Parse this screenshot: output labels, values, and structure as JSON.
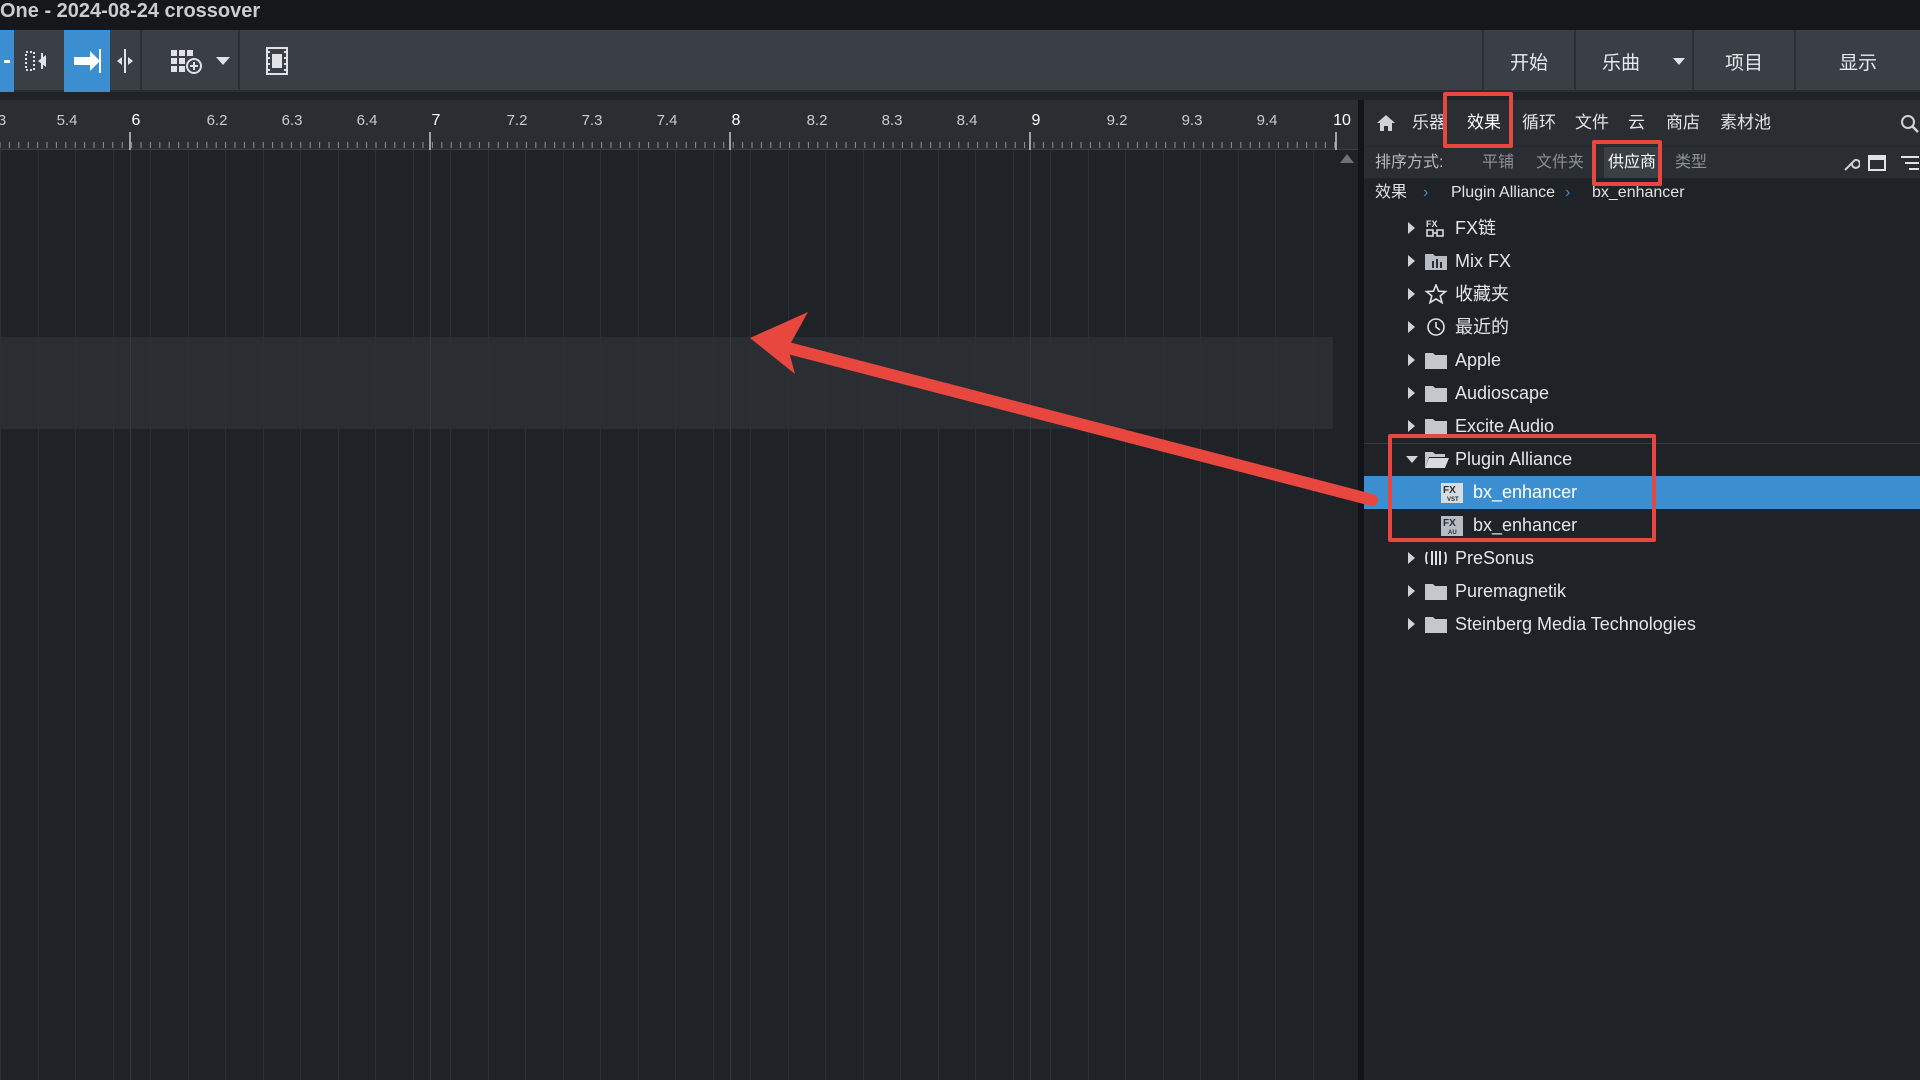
{
  "title": "One - 2024-08-24 crossover",
  "toolbar": {
    "nav": [
      {
        "label": "开始"
      },
      {
        "label": "乐曲"
      },
      {
        "label": "项目"
      },
      {
        "label": "显示"
      }
    ],
    "icons": [
      "locate-icon",
      "snap-arrow-icon",
      "split-icon",
      "grid-add-icon",
      "dropdown-icon",
      "film-icon"
    ],
    "accent": "#3b8fd0"
  },
  "ruler": {
    "labels": [
      "3",
      "5.4",
      "6",
      "6.2",
      "6.3",
      "6.4",
      "7",
      "7.2",
      "7.3",
      "7.4",
      "8",
      "8.2",
      "8.3",
      "8.4",
      "9",
      "9.2",
      "9.3",
      "9.4",
      "10"
    ]
  },
  "browser": {
    "tabs": [
      "乐器",
      "效果",
      "循环",
      "文件",
      "云",
      "商店",
      "素材池"
    ],
    "active_tab": "效果",
    "sort_label": "排序方式:",
    "sort_options": [
      "平铺",
      "文件夹",
      "供应商",
      "类型"
    ],
    "active_sort": "供应商",
    "breadcrumb": [
      "效果",
      "Plugin Alliance",
      "bx_enhancer"
    ],
    "tree": [
      {
        "label": "FX链",
        "icon": "fx-chain-icon",
        "level": 0,
        "expanded": false
      },
      {
        "label": "Mix FX",
        "icon": "mixfx-icon",
        "level": 0,
        "expanded": false
      },
      {
        "label": "收藏夹",
        "icon": "star-icon",
        "level": 0,
        "expanded": false
      },
      {
        "label": "最近的",
        "icon": "clock-icon",
        "level": 0,
        "expanded": false
      },
      {
        "label": "Apple",
        "icon": "folder-icon",
        "level": 0,
        "expanded": false
      },
      {
        "label": "Audioscape",
        "icon": "folder-icon",
        "level": 0,
        "expanded": false
      },
      {
        "label": "Excite Audio",
        "icon": "folder-icon",
        "level": 0,
        "expanded": false
      },
      {
        "label": "Plugin Alliance",
        "icon": "folder-open-icon",
        "level": 0,
        "expanded": true
      },
      {
        "label": "bx_enhancer",
        "icon": "fx-plugin-icon",
        "level": 1,
        "selected": true
      },
      {
        "label": "bx_enhancer",
        "icon": "fx-plugin-icon",
        "level": 1,
        "selected": false
      },
      {
        "label": "PreSonus",
        "icon": "presonus-icon",
        "level": 0,
        "expanded": false
      },
      {
        "label": "Puremagnetik",
        "icon": "folder-icon",
        "level": 0,
        "expanded": false
      },
      {
        "label": "Steinberg Media Technologies",
        "icon": "folder-icon",
        "level": 0,
        "expanded": false
      }
    ]
  },
  "annotation_color": "#e8473f"
}
